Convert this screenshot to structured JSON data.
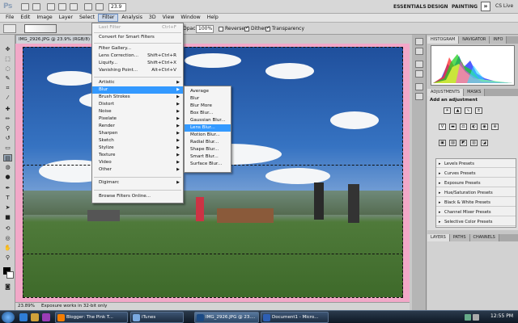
{
  "app": {
    "logo": "Ps",
    "zoom_field": "23.9",
    "workspaces": [
      "ESSENTIALS",
      "DESIGN",
      "PAINTING"
    ],
    "more": "»",
    "cs_live": "CS Live"
  },
  "menubar": [
    "File",
    "Edit",
    "Image",
    "Layer",
    "Select",
    "Filter",
    "Analysis",
    "3D",
    "View",
    "Window",
    "Help"
  ],
  "options": {
    "opacity_label": "Opacity:",
    "opacity": "100%",
    "reverse": "Reverse",
    "dither": "Dither",
    "transparency": "Transparency"
  },
  "document": {
    "tab": "IMG_2926.JPG @ 23.9% (RGB/8)",
    "zoom": "23.89%",
    "status": "Exposure works in 32-bit only"
  },
  "filter_menu": {
    "last_filter": "Last Filter",
    "last_filter_sc": "Ctrl+F",
    "smart": "Convert for Smart Filters",
    "gallery": "Filter Gallery...",
    "lens_correction": "Lens Correction...",
    "lens_correction_sc": "Shift+Ctrl+R",
    "liquify": "Liquify...",
    "liquify_sc": "Shift+Ctrl+X",
    "vanishing": "Vanishing Point...",
    "vanishing_sc": "Alt+Ctrl+V",
    "submenus": [
      "Artistic",
      "Blur",
      "Brush Strokes",
      "Distort",
      "Noise",
      "Pixelate",
      "Render",
      "Sharpen",
      "Sketch",
      "Stylize",
      "Texture",
      "Video",
      "Other"
    ],
    "digimarc": "Digimarc",
    "browse": "Browse Filters Online..."
  },
  "blur_menu": [
    "Average",
    "Blur",
    "Blur More",
    "Box Blur...",
    "Gaussian Blur...",
    "Lens Blur...",
    "Motion Blur...",
    "Radial Blur...",
    "Shape Blur...",
    "Smart Blur...",
    "Surface Blur..."
  ],
  "panels": {
    "histogram_tabs": [
      "HISTOGRAM",
      "NAVIGATOR",
      "INFO"
    ],
    "adjust_tabs": [
      "ADJUSTMENTS",
      "MASKS"
    ],
    "adjust_title": "Add an adjustment",
    "presets": [
      "Levels Presets",
      "Curves Presets",
      "Exposure Presets",
      "Hue/Saturation Presets",
      "Black & White Presets",
      "Channel Mixer Presets",
      "Selective Color Presets"
    ],
    "layers_tabs": [
      "LAYERS",
      "PATHS",
      "CHANNELS"
    ]
  },
  "taskbar": {
    "buttons": [
      "Blogger: The Pink T...",
      "iTunes",
      "IMG_2926.JPG @ 23....",
      "Document1 - Micro..."
    ],
    "clock": "12:55 PM"
  }
}
